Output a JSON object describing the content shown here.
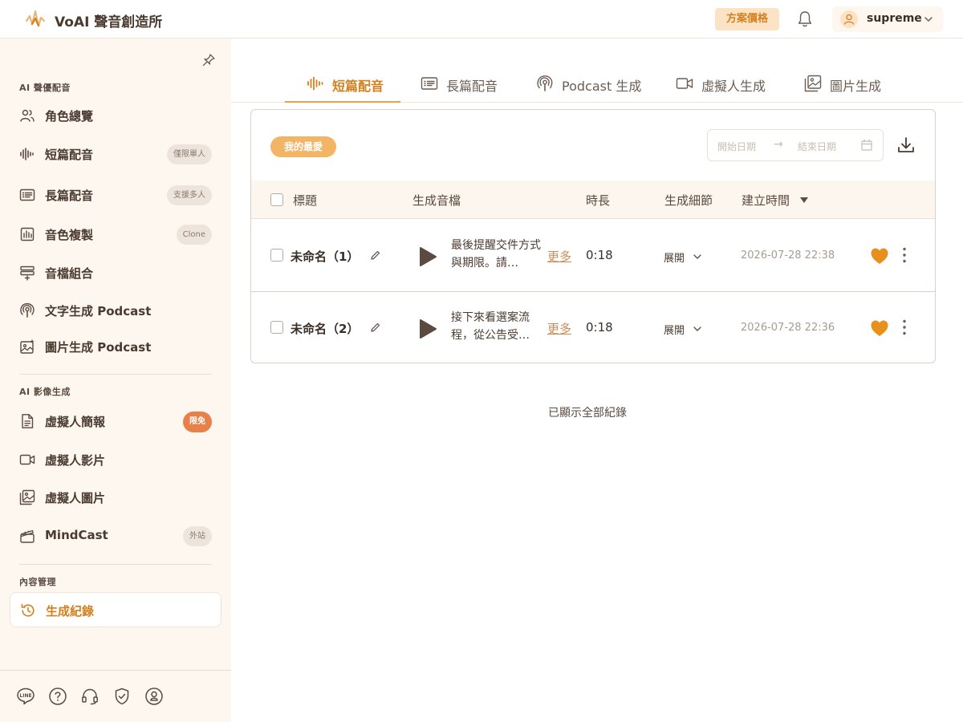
{
  "header": {
    "app_title": "VoAI 聲音創造所",
    "pricing_label": "方案價格",
    "username": "supreme"
  },
  "sidebar": {
    "sections": [
      {
        "label": "AI 聲優配音",
        "items": [
          {
            "label": "角色總覽",
            "icon": "users-icon"
          },
          {
            "label": "短篇配音",
            "icon": "waveform-icon",
            "badge": "僅限單人"
          },
          {
            "label": "長篇配音",
            "icon": "document-list-icon",
            "badge": "支援多人"
          },
          {
            "label": "音色複製",
            "icon": "voice-clone-icon",
            "badge": "Clone"
          },
          {
            "label": "音檔組合",
            "icon": "audio-merge-icon"
          },
          {
            "label": "文字生成 Podcast",
            "icon": "podcast-icon"
          },
          {
            "label": "圖片生成 Podcast",
            "icon": "image-sparkle-icon"
          }
        ]
      },
      {
        "label": "AI 影像生成",
        "items": [
          {
            "label": "虛擬人簡報",
            "icon": "file-text-icon",
            "badge": "限免"
          },
          {
            "label": "虛擬人影片",
            "icon": "video-icon"
          },
          {
            "label": "虛擬人圖片",
            "icon": "image-icon"
          },
          {
            "label": "MindCast",
            "icon": "clapperboard-icon",
            "badge": "外站"
          }
        ]
      },
      {
        "label": "內容管理",
        "items": [
          {
            "label": "生成紀錄",
            "icon": "history-icon"
          }
        ]
      }
    ],
    "footer_icons": [
      "line-icon",
      "help-icon",
      "headset-icon",
      "shield-icon",
      "account-icon"
    ]
  },
  "tabs": [
    {
      "label": "短篇配音",
      "icon": "waveform-icon",
      "active": true
    },
    {
      "label": "長篇配音",
      "icon": "document-list-icon",
      "active": false
    },
    {
      "label": "Podcast 生成",
      "icon": "podcast-icon",
      "active": false
    },
    {
      "label": "虛擬人生成",
      "icon": "video-icon",
      "active": false
    },
    {
      "label": "圖片生成",
      "icon": "image-icon",
      "active": false
    }
  ],
  "filters": {
    "favorite_chip": "我的最愛",
    "date_start_placeholder": "開始日期",
    "date_arrow": "→",
    "date_end_placeholder": "結束日期"
  },
  "table": {
    "columns": [
      "標題",
      "生成音檔",
      "時長",
      "生成細節",
      "建立時間"
    ],
    "rows": [
      {
        "title": "未命名（1）",
        "preview": "最後提醒交件方式與期限。請…",
        "more": "更多",
        "duration": "0:18",
        "details": "展開",
        "created": "2026-07-28 22:38",
        "favorite": true
      },
      {
        "title": "未命名（2）",
        "preview": "接下來看選案流程，從公告受…",
        "more": "更多",
        "duration": "0:18",
        "details": "展開",
        "created": "2026-07-28 22:36",
        "favorite": true
      }
    ],
    "end_note": "已顯示全部紀錄"
  },
  "colors": {
    "accent": "#d4801e",
    "sidebar_bg": "#fdf7f0",
    "favorite": "#e8901e"
  }
}
